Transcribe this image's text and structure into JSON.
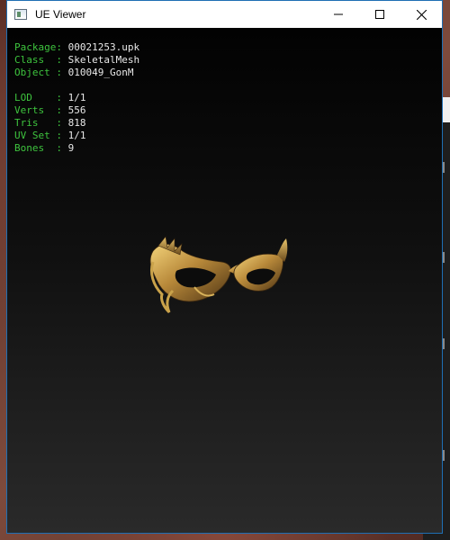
{
  "window": {
    "title": "UE Viewer",
    "icon": "ue-viewer-app-icon",
    "controls": [
      "minimize-icon",
      "maximize-icon",
      "close-icon"
    ]
  },
  "info": {
    "package_key": "Package:",
    "package_value": "00021253.upk",
    "class_key": "Class  :",
    "class_value": "SkeletalMesh",
    "object_key": "Object :",
    "object_value": "010049_GonM",
    "lod_key": "LOD    :",
    "lod_value": "1/1",
    "verts_key": "Verts  :",
    "verts_value": "556",
    "tris_key": "Tris   :",
    "tris_value": "818",
    "uvset_key": "UV Set :",
    "uvset_value": "1/1",
    "bones_key": "Bones  :",
    "bones_value": "9"
  },
  "colors": {
    "label_green": "#3ec43e",
    "value_white": "#e8e8e8",
    "mesh_gold": "#c9a24a",
    "window_border": "#1f6fb4"
  }
}
